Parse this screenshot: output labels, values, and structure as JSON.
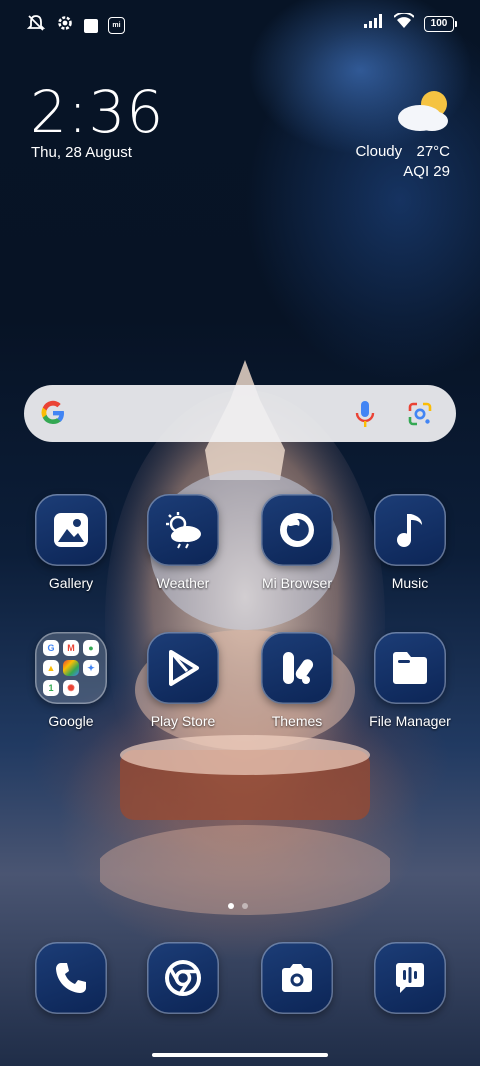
{
  "status_bar": {
    "left_icons": [
      "notification-muted-icon",
      "gear-icon",
      "square-icon",
      "mi-icon"
    ],
    "right_icons": [
      "signal-icon",
      "wifi-icon"
    ],
    "battery": "100"
  },
  "clock": {
    "time": "2:36",
    "date": "Thu, 28 August"
  },
  "weather": {
    "condition": "Cloudy",
    "temperature": "27°C",
    "aqi": "AQI 29"
  },
  "apps_row1": [
    {
      "label": "Gallery",
      "icon": "gallery-icon"
    },
    {
      "label": "Weather",
      "icon": "weather-icon"
    },
    {
      "label": "Mi Browser",
      "icon": "browser-icon"
    },
    {
      "label": "Music",
      "icon": "music-icon"
    }
  ],
  "apps_row2": [
    {
      "label": "Google",
      "icon": "google-folder-icon"
    },
    {
      "label": "Play Store",
      "icon": "play-store-icon"
    },
    {
      "label": "Themes",
      "icon": "themes-icon"
    },
    {
      "label": "File Manager",
      "icon": "file-manager-icon"
    }
  ],
  "google_folder_items": [
    "G",
    "M",
    "Maps",
    "Drive",
    "Photos",
    "Files",
    "Pay",
    "Meet",
    "Assistant"
  ],
  "dock": [
    "phone-icon",
    "chrome-icon",
    "camera-icon",
    "messages-icon"
  ],
  "page_indicator": {
    "pages": 2,
    "current": 1
  }
}
